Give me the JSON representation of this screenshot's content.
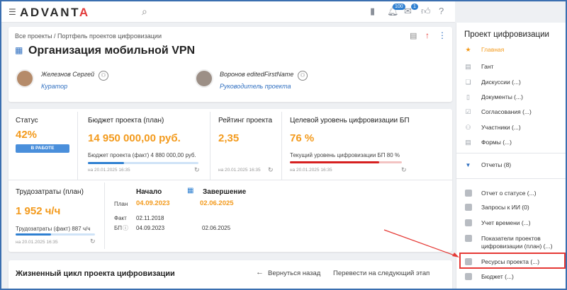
{
  "topbar": {
    "logo_a": "ADVANT",
    "logo_b": "A",
    "badge_1": "100",
    "badge_2": "1"
  },
  "project": {
    "breadcrumb": "Все проекты / Портфель проектов цифровизации",
    "title": "Организация мобильной VPN"
  },
  "people": [
    {
      "name": "Железнов Сергей",
      "role": "Куратор"
    },
    {
      "name": "Воронов editedFirstName",
      "role": "Руководитель проекта"
    }
  ],
  "metrics": {
    "status": {
      "label": "Статус",
      "value": "42%",
      "progress": 0.42,
      "badge": "В РАБОТЕ"
    },
    "budget": {
      "label": "Бюджет проекта (план)",
      "value": "14 950 000,00 руб.",
      "fact_label": "Бюджет проекта (факт)  4 880 000,00 руб.",
      "fact_progress": 0.33,
      "date": "на 20.01.2025 16:35"
    },
    "rating": {
      "label": "Рейтинг проекта",
      "value": "2,35",
      "date": "на 20.01.2025 16:35"
    },
    "digital": {
      "label": "Целевой уровень цифровизации БП",
      "value": "76 %",
      "current_label": "Текущий уровень цифровизации БП  80 %",
      "current_progress": 0.8,
      "date": "на 20.01.2025 16:35"
    },
    "labor": {
      "label": "Трудозатраты (план)",
      "value": "1 952 ч/ч",
      "fact_label": "Трудозатраты (факт)  887 ч/ч",
      "fact_progress": 0.45,
      "date": "на 20.01.2025 16:35"
    }
  },
  "dates": {
    "start_h": "Начало",
    "end_h": "Завершение",
    "plan_k": "План",
    "fact_k": "Факт",
    "bp_k": "БП",
    "plan_start": "04.09.2023",
    "plan_end": "02.06.2025",
    "fact_start": "02.11.2018",
    "bp_start": "04.09.2023",
    "bp_end": "02.06.2025"
  },
  "lifecycle": {
    "title": "Жизненный цикл проекта цифровизации",
    "back": "Вернуться назад",
    "next": "Перевести на следующий этап"
  },
  "sidebar": {
    "title": "Проект цифровизации",
    "items": [
      {
        "label": "Главная",
        "icon": "star-icon",
        "active": true
      },
      {
        "label": "Гант",
        "icon": "gantt-icon"
      },
      {
        "label": "Дискуссии (...)",
        "icon": "chat-icon"
      },
      {
        "label": "Документы (...)",
        "icon": "document-icon"
      },
      {
        "label": "Согласования (...)",
        "icon": "approval-icon"
      },
      {
        "label": "Участники (...)",
        "icon": "people-icon"
      },
      {
        "label": "Формы (...)",
        "icon": "form-icon"
      },
      {
        "label": "Отчеты (8)",
        "icon": "triangle-down-icon"
      },
      {
        "label": "Отчет о статусе (...)",
        "icon": "report-icon"
      },
      {
        "label": "Запросы к ИИ (0)",
        "icon": "report-icon"
      },
      {
        "label": "Учет времени (...)",
        "icon": "report-icon"
      },
      {
        "label": "Показатели проектов цифровизации (план) (...)",
        "icon": "report-icon"
      },
      {
        "label": "Ресурсы проекта (...)",
        "icon": "report-icon"
      },
      {
        "label": "Бюджет (...)",
        "icon": "report-icon"
      }
    ]
  },
  "colors": {
    "accent": "#f39a1c",
    "primary": "#2f80d1",
    "highlight": "#e53935"
  }
}
